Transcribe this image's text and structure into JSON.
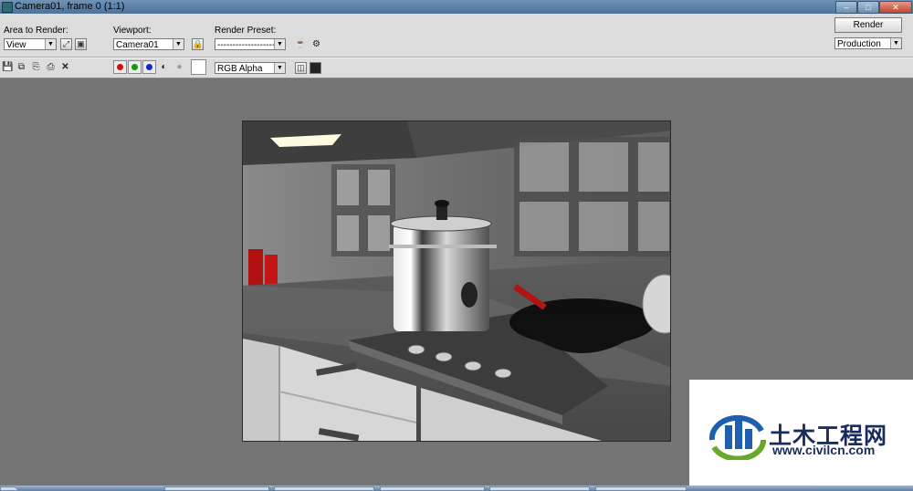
{
  "window": {
    "title": "Camera01, frame 0 (1:1)",
    "controls": [
      "–",
      "□",
      "✕"
    ]
  },
  "area_to_render": {
    "label": "Area to Render:",
    "value": "View"
  },
  "viewport": {
    "label": "Viewport:",
    "value": "Camera01"
  },
  "render_preset": {
    "label": "Render Preset:",
    "value": "--------------------------"
  },
  "render_button": {
    "label": "Render"
  },
  "render_mode": {
    "value": "Production"
  },
  "channel_display": {
    "value": "RGB Alpha"
  },
  "channels": [
    {
      "name": "red-channel",
      "color": "#d01010"
    },
    {
      "name": "green-channel",
      "color": "#129a12"
    },
    {
      "name": "blue-channel",
      "color": "#1028c8"
    }
  ],
  "watermark": {
    "title": "土木工程网",
    "url": "www.civilcn.com",
    "colors": {
      "blue": "#1f5fb0",
      "green": "#6aa82a",
      "text": "#1a2c5b"
    }
  },
  "colors": {
    "background": "#747474",
    "toolbar": "#dcdcdc",
    "titlebar": "#5f84aa"
  }
}
